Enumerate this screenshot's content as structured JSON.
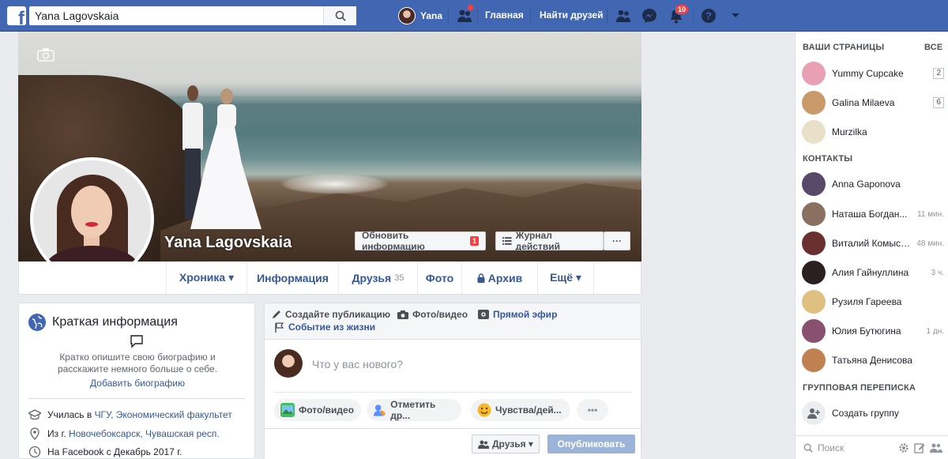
{
  "topbar": {
    "search_value": "Yana Lagovskaia",
    "user_name": "Yana",
    "home": "Главная",
    "find_friends": "Найти друзей",
    "notifications_count": "10"
  },
  "cover": {
    "name": "Yana Lagovskaia",
    "update_info": "Обновить информацию",
    "update_badge": "1",
    "activity_log": "Журнал действий",
    "more": "···"
  },
  "tabs": [
    {
      "label": "Хроника ▾"
    },
    {
      "label": "Информация"
    },
    {
      "label": "Друзья",
      "count": "35"
    },
    {
      "label": "Фото"
    },
    {
      "label": "Архив"
    },
    {
      "label": "Ещё ▾"
    }
  ],
  "intro": {
    "title": "Краткая информация",
    "bio_prompt": "Кратко опишите свою биографию и расскажите немного больше о себе.",
    "add_bio": "Добавить биографию",
    "study_prefix": "Училась в ",
    "study_link": "ЧГУ, Экономический факультет",
    "from_prefix": "Из г. ",
    "from_link": "Новочебоксарск, Чувашская респ.",
    "joined": "На Facebook с Декабрь 2017 г."
  },
  "composer": {
    "create_post": "Создайте публикацию",
    "photo_video": "Фото/видео",
    "live": "Прямой эфир",
    "life_event": "Событие из жизни",
    "placeholder": "Что у вас нового?",
    "pill_photo": "Фото/видео",
    "pill_tag": "Отметить др...",
    "pill_feeling": "Чувства/дей...",
    "pill_more": "•••",
    "audience": "Друзья ▾",
    "publish": "Опубликовать"
  },
  "sidebar": {
    "pages_header": "ВАШИ СТРАНИЦЫ",
    "pages_all": "ВСЕ",
    "pages": [
      {
        "name": "Yummy Cupcake",
        "count": "2",
        "color": "#e8a0b4"
      },
      {
        "name": "Galina Milaeva",
        "count": "6",
        "color": "#c89a6a"
      },
      {
        "name": "Murzilka",
        "count": "",
        "color": "#e8e0c8"
      }
    ],
    "contacts_header": "КОНТАКТЫ",
    "contacts": [
      {
        "name": "Anna Gaponova",
        "time": "",
        "color": "#5a4a6a"
      },
      {
        "name": "Наташа Богдан...",
        "time": "11 мин.",
        "color": "#8a7060"
      },
      {
        "name": "Виталий Комысов",
        "time": "48 мин.",
        "color": "#6a3030"
      },
      {
        "name": "Алия Гайнуллина",
        "time": "3 ч.",
        "color": "#2a2020"
      },
      {
        "name": "Рузиля Гареева",
        "time": "",
        "color": "#e0c080"
      },
      {
        "name": "Юлия Бутюгина",
        "time": "1 дн.",
        "color": "#8a5070"
      },
      {
        "name": "Татьяна Денисова",
        "time": "",
        "color": "#c08050"
      }
    ],
    "groups_header": "ГРУППОВАЯ ПЕРЕПИСКА",
    "create_group": "Создать группу",
    "search_placeholder": "Поиск"
  }
}
